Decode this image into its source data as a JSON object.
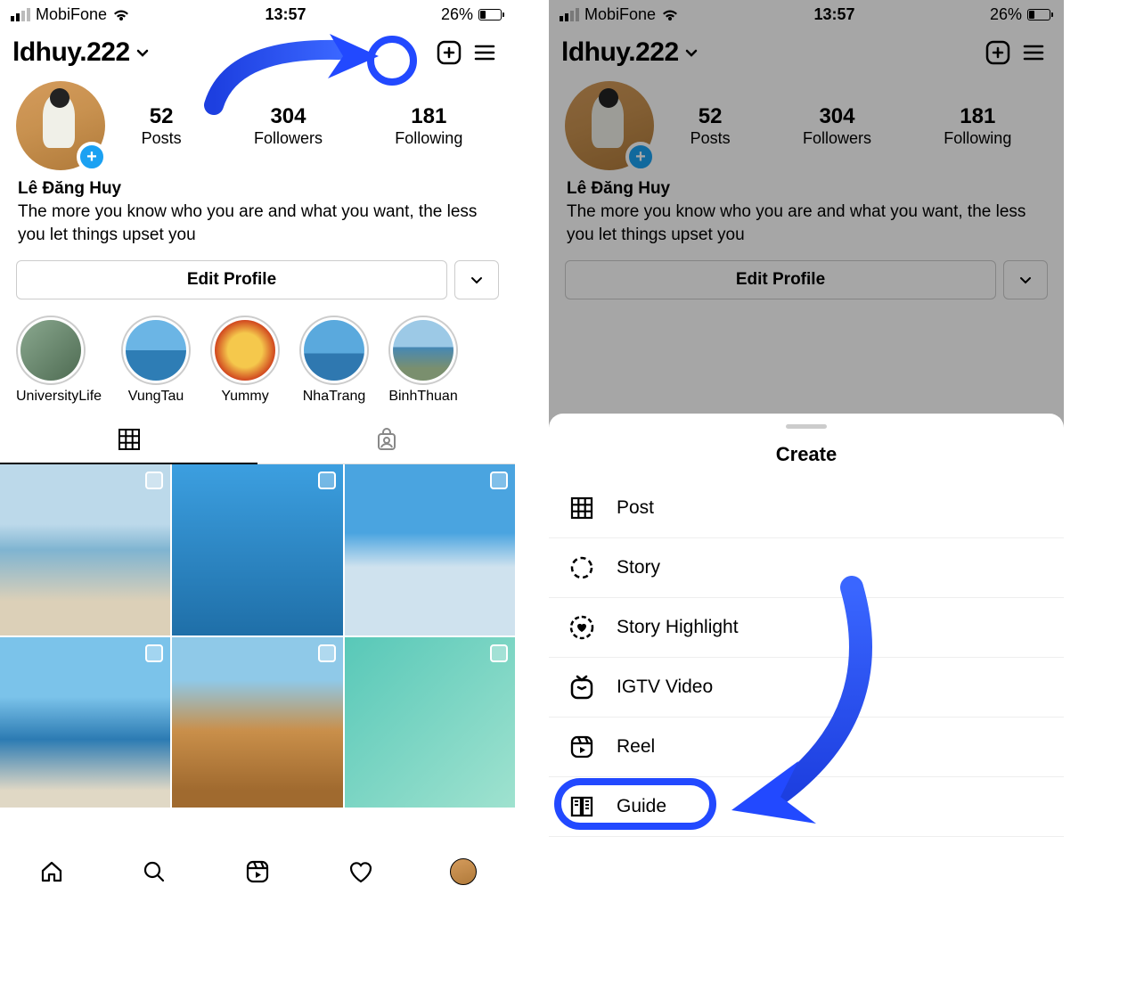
{
  "status": {
    "carrier": "MobiFone",
    "time": "13:57",
    "battery_pct": "26%"
  },
  "profile": {
    "username": "ldhuy.222",
    "stats": {
      "posts": "52",
      "posts_label": "Posts",
      "followers": "304",
      "followers_label": "Followers",
      "following": "181",
      "following_label": "Following"
    },
    "display_name": "Lê Đăng Huy",
    "bio": "The more you know who you are and what you want, the less you let things upset you",
    "edit_label": "Edit Profile"
  },
  "highlights": [
    {
      "label": "UniversityLife"
    },
    {
      "label": "VungTau"
    },
    {
      "label": "Yummy"
    },
    {
      "label": "NhaTrang"
    },
    {
      "label": "BinhThuan"
    }
  ],
  "create_sheet": {
    "title": "Create",
    "options": [
      {
        "icon": "grid-icon",
        "label": "Post"
      },
      {
        "icon": "story-ring-icon",
        "label": "Story"
      },
      {
        "icon": "highlight-heart-icon",
        "label": "Story Highlight"
      },
      {
        "icon": "igtv-icon",
        "label": "IGTV Video"
      },
      {
        "icon": "reel-icon",
        "label": "Reel"
      },
      {
        "icon": "guide-icon",
        "label": "Guide"
      }
    ]
  },
  "annotation": {
    "highlighted_button": "create-button",
    "highlighted_option": "Guide"
  },
  "colors": {
    "accent": "#2249ff",
    "story_badge": "#1ba1f2"
  }
}
